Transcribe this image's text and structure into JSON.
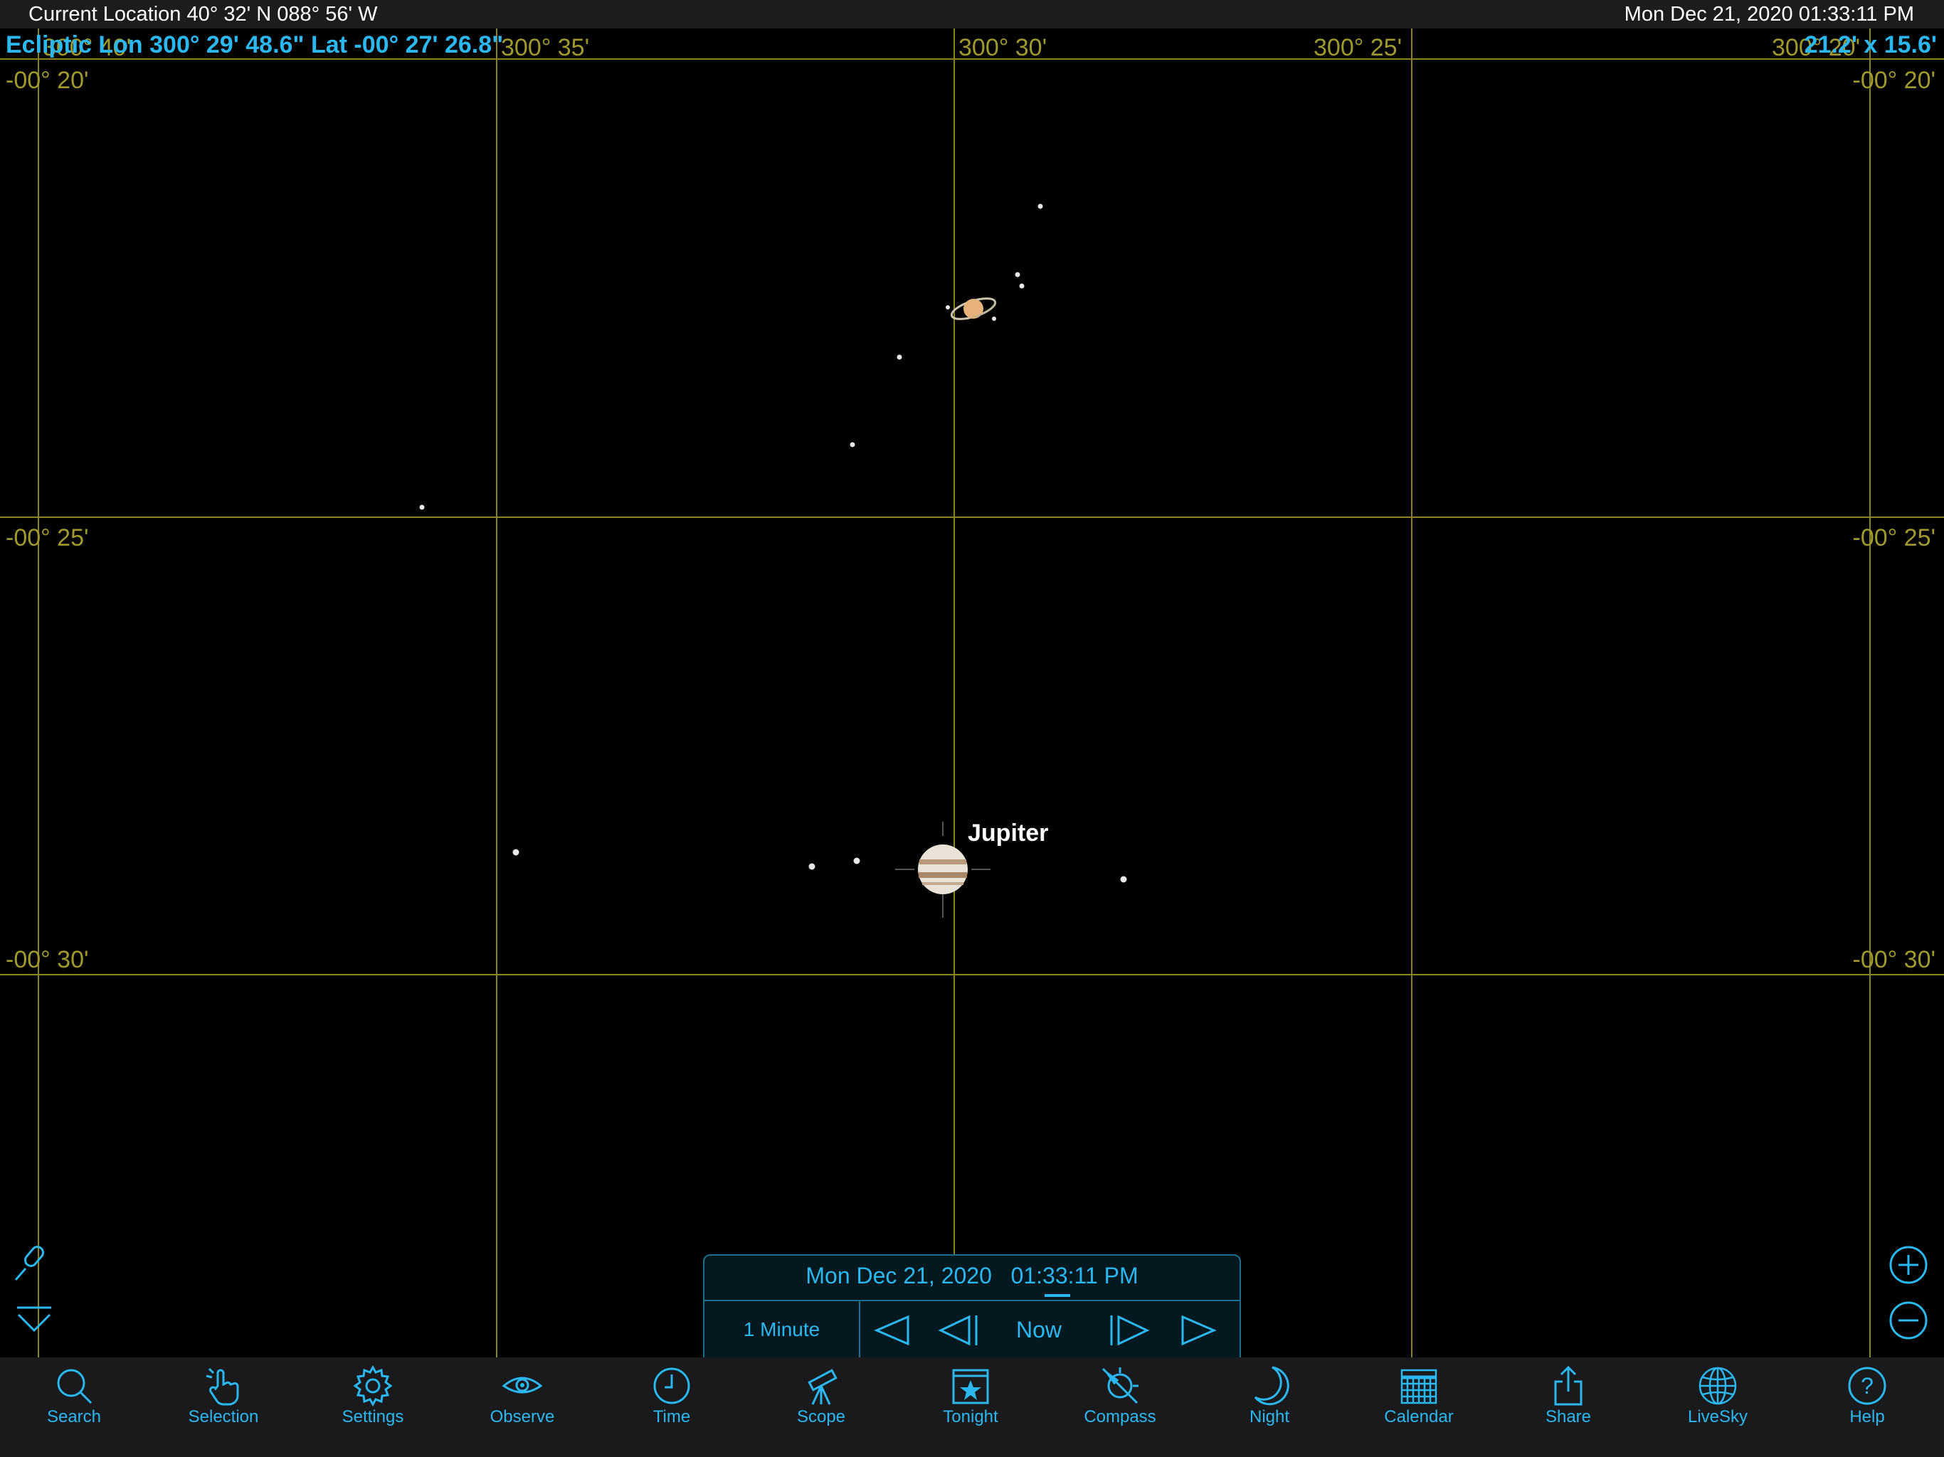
{
  "status_bar": {
    "location": "Current Location  40° 32' N 088° 56' W",
    "datetime": "Mon Dec 21, 2020  01:33:11 PM"
  },
  "sky": {
    "readout_coords": "Ecliptic Lon 300° 29' 48.6\" Lat -00° 27' 26.8\"",
    "readout_fov": "21.2' x 15.6'",
    "lon_labels": [
      "300° 40'",
      "300° 35'",
      "300° 30'",
      "300° 25'",
      "300° 20'"
    ],
    "lat_labels": [
      "-00° 20'",
      "-00° 25'",
      "-00° 30'"
    ],
    "object_label": "Jupiter"
  },
  "time_panel": {
    "datetime": "Mon Dec 21, 2020   01:33:11 PM",
    "step": "1 Minute",
    "now_label": "Now"
  },
  "toolbar": {
    "items": [
      {
        "label": "Search",
        "icon": "search-icon"
      },
      {
        "label": "Selection",
        "icon": "selection-hand-icon"
      },
      {
        "label": "Settings",
        "icon": "gear-icon"
      },
      {
        "label": "Observe",
        "icon": "eye-icon"
      },
      {
        "label": "Time",
        "icon": "clock-icon"
      },
      {
        "label": "Scope",
        "icon": "telescope-icon"
      },
      {
        "label": "Tonight",
        "icon": "star-calendar-icon"
      },
      {
        "label": "Compass",
        "icon": "compass-icon"
      },
      {
        "label": "Night",
        "icon": "moon-icon"
      },
      {
        "label": "Calendar",
        "icon": "calendar-grid-icon"
      },
      {
        "label": "Share",
        "icon": "share-icon"
      },
      {
        "label": "LiveSky",
        "icon": "globe-icon"
      },
      {
        "label": "Help",
        "icon": "help-icon"
      }
    ]
  },
  "colors": {
    "accent": "#2bb8f0",
    "grid": "#8a8420",
    "grid_label": "#a09a2e",
    "background": "#000000"
  }
}
